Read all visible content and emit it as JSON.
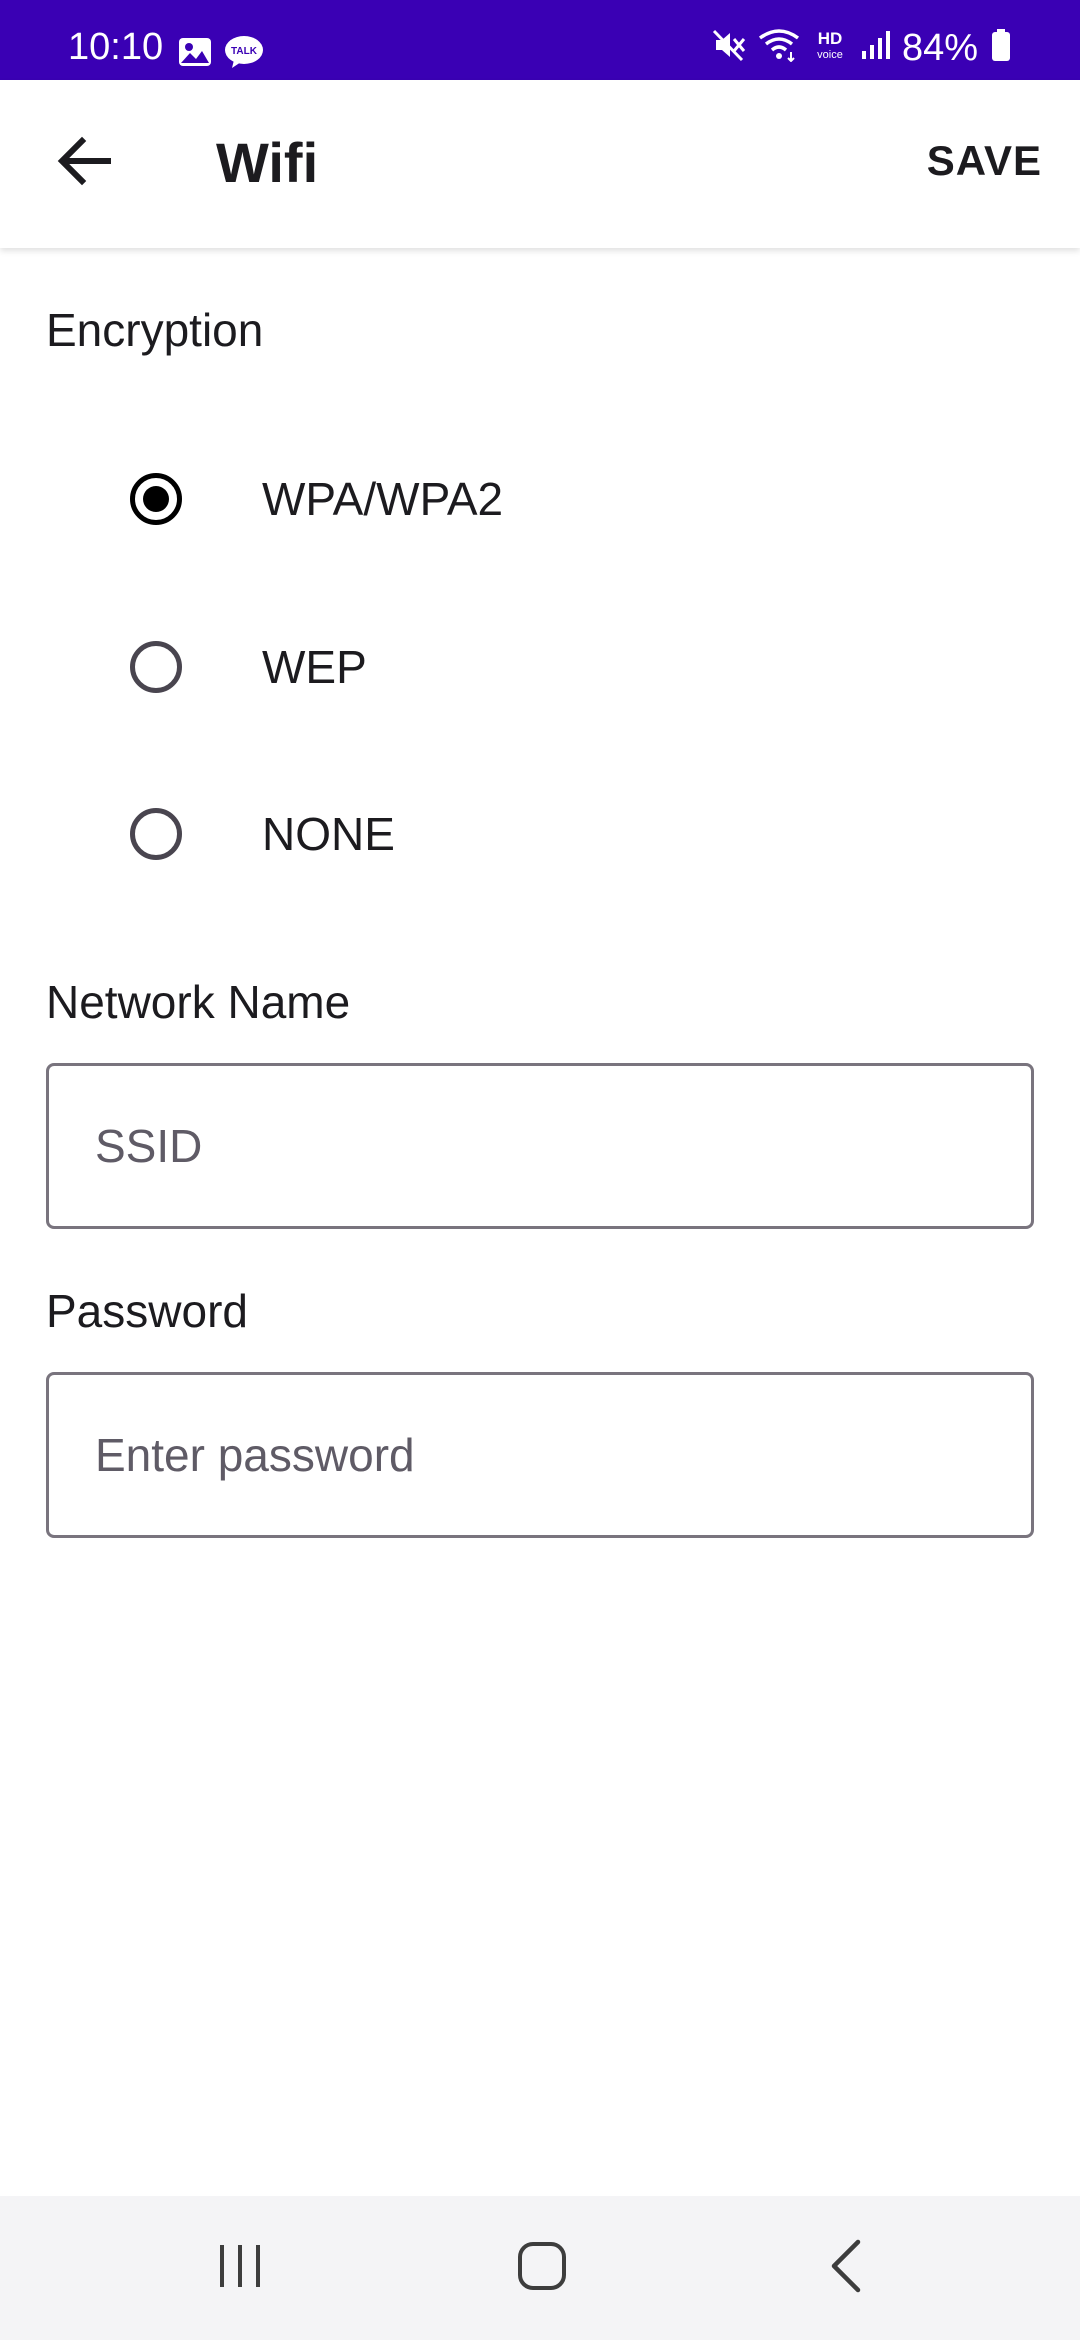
{
  "status_bar": {
    "time": "10:10",
    "battery": "84%",
    "background_color": "#3a00b4",
    "left_icons": [
      "gallery-icon",
      "talk-icon"
    ],
    "right_icons": [
      "mute-icon",
      "wifi-icon",
      "hd-voice-icon",
      "signal-icon",
      "battery-icon"
    ],
    "talk_badge": "TALK",
    "hd_label": "HD",
    "voice_label": "voice"
  },
  "app_bar": {
    "title": "Wifi",
    "save_label": "SAVE",
    "back_icon": "arrow-back-icon"
  },
  "encryption": {
    "label": "Encryption",
    "options": [
      {
        "label": "WPA/WPA2",
        "selected": true
      },
      {
        "label": "WEP",
        "selected": false
      },
      {
        "label": "NONE",
        "selected": false
      }
    ]
  },
  "network_name": {
    "label": "Network Name",
    "value": "",
    "placeholder": "SSID"
  },
  "password": {
    "label": "Password",
    "value": "",
    "placeholder": "Enter password"
  },
  "nav_bar": {
    "icons": [
      "recent-apps-icon",
      "home-icon",
      "back-icon"
    ]
  }
}
